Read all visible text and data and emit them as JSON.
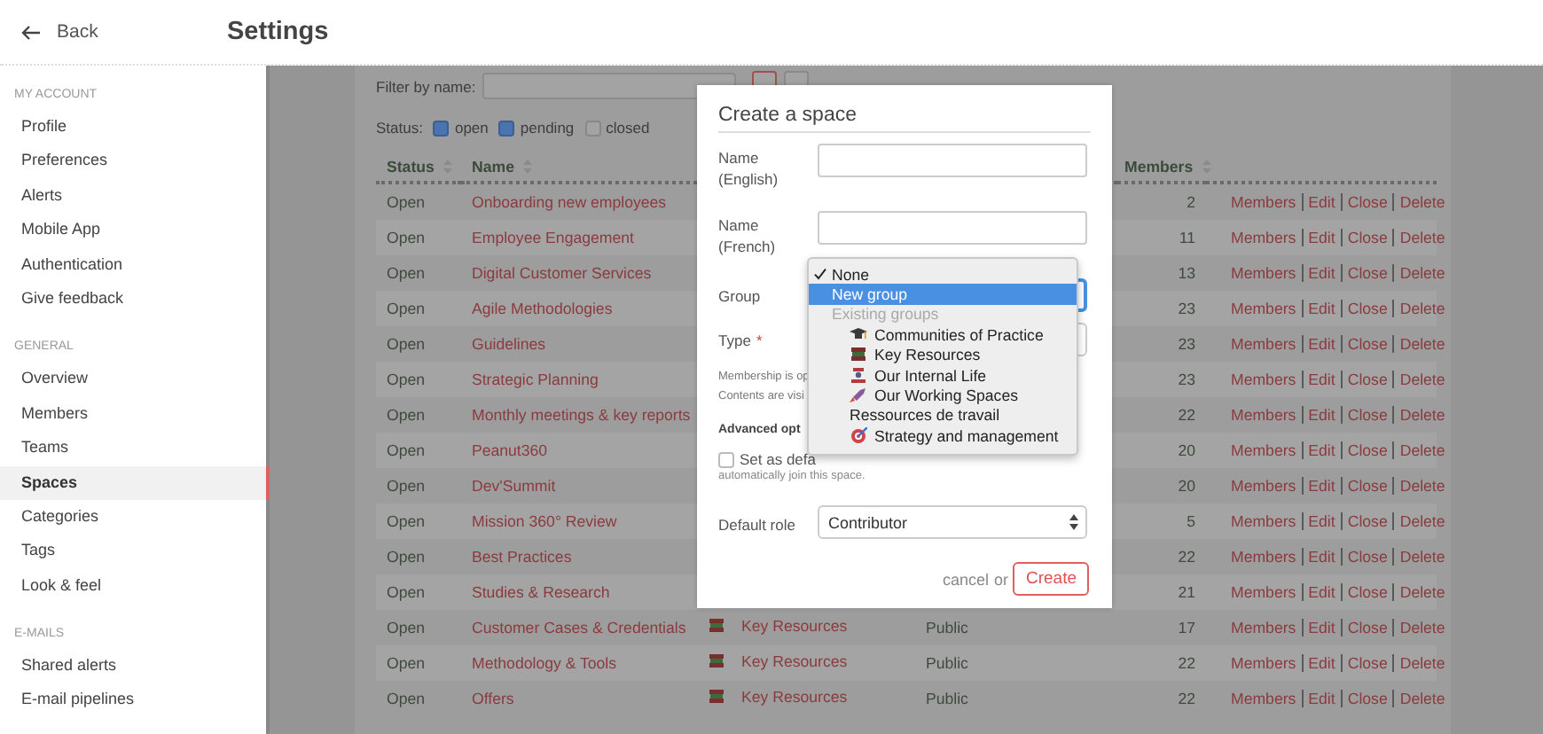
{
  "header": {
    "back": "Back",
    "title": "Settings"
  },
  "sidebar": {
    "sections": [
      {
        "heading": "MY ACCOUNT",
        "items": [
          {
            "label": "Profile",
            "selected": false
          },
          {
            "label": "Preferences",
            "selected": false
          },
          {
            "label": "Alerts",
            "selected": false
          },
          {
            "label": "Mobile App",
            "selected": false
          },
          {
            "label": "Authentication",
            "selected": false
          },
          {
            "label": "Give feedback",
            "selected": false
          }
        ]
      },
      {
        "heading": "GENERAL",
        "items": [
          {
            "label": "Overview",
            "selected": false
          },
          {
            "label": "Members",
            "selected": false
          },
          {
            "label": "Teams",
            "selected": false
          },
          {
            "label": "Spaces",
            "selected": true
          },
          {
            "label": "Categories",
            "selected": false
          },
          {
            "label": "Tags",
            "selected": false
          },
          {
            "label": "Look & feel",
            "selected": false
          }
        ]
      },
      {
        "heading": "E-MAILS",
        "items": [
          {
            "label": "Shared alerts",
            "selected": false
          },
          {
            "label": "E-mail pipelines",
            "selected": false
          }
        ]
      }
    ]
  },
  "filter": {
    "label": "Filter by name:",
    "status_label": "Status:",
    "statuses": [
      {
        "label": "open",
        "checked": true
      },
      {
        "label": "pending",
        "checked": true
      },
      {
        "label": "closed",
        "checked": false
      }
    ]
  },
  "table": {
    "columns": [
      "Status",
      "Name",
      "Members"
    ],
    "rows": [
      {
        "status": "Open",
        "name": "Onboarding new employees",
        "members": "2",
        "actions": [
          "Members",
          "Edit",
          "Close",
          "Delete"
        ]
      },
      {
        "status": "Open",
        "name": "Employee Engagement",
        "members": "11",
        "actions": [
          "Members",
          "Edit",
          "Close",
          "Delete"
        ]
      },
      {
        "status": "Open",
        "name": "Digital Customer Services",
        "members": "13",
        "actions": [
          "Members",
          "Edit",
          "Close",
          "Delete"
        ]
      },
      {
        "status": "Open",
        "name": "Agile Methodologies",
        "members": "23",
        "actions": [
          "Members",
          "Edit",
          "Close",
          "Delete"
        ]
      },
      {
        "status": "Open",
        "name": "Guidelines",
        "members": "23",
        "actions": [
          "Members",
          "Edit",
          "Close",
          "Delete"
        ]
      },
      {
        "status": "Open",
        "name": "Strategic Planning",
        "members": "23",
        "actions": [
          "Members",
          "Edit",
          "Close",
          "Delete"
        ]
      },
      {
        "status": "Open",
        "name": "Monthly meetings & key reports",
        "members": "22",
        "actions": [
          "Members",
          "Edit",
          "Close",
          "Delete"
        ]
      },
      {
        "status": "Open",
        "name": "Peanut360",
        "members": "20",
        "actions": [
          "Members",
          "Edit",
          "Close",
          "Delete"
        ]
      },
      {
        "status": "Open",
        "name": "Dev'Summit",
        "members": "20",
        "actions": [
          "Members",
          "Edit",
          "Close",
          "Delete"
        ]
      },
      {
        "status": "Open",
        "name": "Mission 360° Review",
        "members": "5",
        "actions": [
          "Members",
          "Edit",
          "Close",
          "Delete"
        ]
      },
      {
        "status": "Open",
        "name": "Best Practices",
        "members": "22",
        "actions": [
          "Members",
          "Edit",
          "Close",
          "Delete"
        ]
      },
      {
        "status": "Open",
        "name": "Studies & Research",
        "members": "21",
        "actions": [
          "Members",
          "Edit",
          "Close",
          "Delete"
        ]
      },
      {
        "status": "Open",
        "name": "Customer Cases & Credentials",
        "group": "Key Resources",
        "type": "Public",
        "members": "17",
        "actions": [
          "Members",
          "Edit",
          "Close",
          "Delete"
        ]
      },
      {
        "status": "Open",
        "name": "Methodology & Tools",
        "group": "Key Resources",
        "type": "Public",
        "members": "22",
        "actions": [
          "Members",
          "Edit",
          "Close",
          "Delete"
        ]
      },
      {
        "status": "Open",
        "name": "Offers",
        "group": "Key Resources",
        "type": "Public",
        "members": "22",
        "actions": [
          "Members",
          "Edit",
          "Close",
          "Delete"
        ]
      }
    ]
  },
  "dialog": {
    "title": "Create a space",
    "fields": [
      {
        "kind": "text",
        "label": "Name (English)"
      },
      {
        "kind": "text",
        "label": "Name (French)"
      },
      {
        "kind": "select",
        "label": "Group",
        "focused": true
      },
      {
        "kind": "select",
        "label": "Type",
        "required_mark": "*",
        "focused": false
      }
    ],
    "notes": [
      "Membership is op",
      "Contents are visi"
    ],
    "advanced_heading": "Advanced opt",
    "default_space": {
      "label": "Set as defa",
      "checked": false,
      "hint": "automatically join this space."
    },
    "default_role": {
      "label": "Default role",
      "value": "Contributor"
    },
    "cancel": "cancel",
    "or": "or",
    "submit": "Create"
  },
  "group_menu": {
    "options": [
      {
        "kind": "option",
        "label": "None",
        "checked": true,
        "selected": false
      },
      {
        "kind": "option",
        "label": "New group",
        "checked": false,
        "selected": true
      },
      {
        "kind": "group-header",
        "label": "Existing groups",
        "children": [
          {
            "label": "Communities of Practice",
            "selected": false
          },
          {
            "label": "Key Resources",
            "selected": false
          },
          {
            "label": "Our Internal Life",
            "selected": false
          },
          {
            "label": "Our Working Spaces",
            "selected": false
          },
          {
            "label": "Ressources de travail",
            "selected": false
          },
          {
            "label": "Strategy and management",
            "selected": false
          }
        ]
      }
    ]
  }
}
